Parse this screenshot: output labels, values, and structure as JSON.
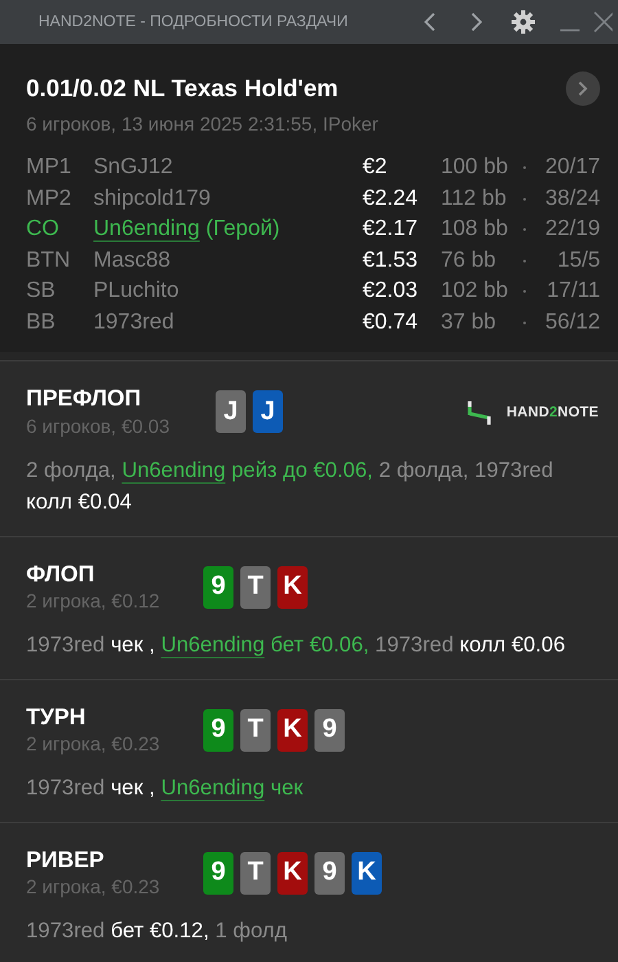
{
  "window": {
    "title": "HAND2NOTE - ПОДРОБНОСТИ РАЗДАЧИ"
  },
  "hand": {
    "game": "0.01/0.02 NL Texas Hold'em",
    "info": "6 игроков, 13 июня 2025 2:31:55, IPoker"
  },
  "players": [
    {
      "position": "MP1",
      "name": "SnGJ12",
      "hero": false,
      "stack": "€2",
      "bb": "100 bb",
      "stats": "20/17"
    },
    {
      "position": "MP2",
      "name": "shipcold179",
      "hero": false,
      "stack": "€2.24",
      "bb": "112 bb",
      "stats": "38/24"
    },
    {
      "position": "CO",
      "name": "Un6ending",
      "hero": true,
      "hero_label": "(Герой)",
      "stack": "€2.17",
      "bb": "108 bb",
      "stats": "22/19"
    },
    {
      "position": "BTN",
      "name": "Masc88",
      "hero": false,
      "stack": "€1.53",
      "bb": "76 bb",
      "stats": "15/5"
    },
    {
      "position": "SB",
      "name": "PLuchito",
      "hero": false,
      "stack": "€2.03",
      "bb": "102 bb",
      "stats": "17/11"
    },
    {
      "position": "BB",
      "name": "1973red",
      "hero": false,
      "stack": "€0.74",
      "bb": "37 bb",
      "stats": "56/12"
    }
  ],
  "logo": {
    "before": "HAND",
    "accent": "2",
    "after": "NOTE"
  },
  "streets": [
    {
      "name": "ПРЕФЛОП",
      "info": "6 игроков, €0.03",
      "logo": true,
      "cards": [
        {
          "rank": "J",
          "color": "#6a6a6a"
        },
        {
          "rank": "J",
          "color": "#0d5bb5"
        }
      ],
      "actions": [
        {
          "kind": "plain",
          "text": "2 фолда, "
        },
        {
          "kind": "hero-name",
          "text": "Un6ending"
        },
        {
          "kind": "hero",
          "text": " рейз до €0.06,"
        },
        {
          "kind": "plain",
          "text": " 2 фолда, 1973red "
        },
        {
          "kind": "bold",
          "text": "колл €0.04"
        }
      ]
    },
    {
      "name": "ФЛОП",
      "info": "2 игрока, €0.12",
      "cards": [
        {
          "rank": "9",
          "color": "#0e8a1b"
        },
        {
          "rank": "T",
          "color": "#6a6a6a"
        },
        {
          "rank": "K",
          "color": "#a30d0d"
        }
      ],
      "actions": [
        {
          "kind": "plain",
          "text": "1973red "
        },
        {
          "kind": "bold",
          "text": "чек , "
        },
        {
          "kind": "hero-name",
          "text": "Un6ending"
        },
        {
          "kind": "hero",
          "text": " бет €0.06,"
        },
        {
          "kind": "plain",
          "text": " 1973red "
        },
        {
          "kind": "bold",
          "text": "колл €0.06"
        }
      ]
    },
    {
      "name": "ТУРН",
      "info": "2 игрока, €0.23",
      "cards": [
        {
          "rank": "9",
          "color": "#0e8a1b"
        },
        {
          "rank": "T",
          "color": "#6a6a6a"
        },
        {
          "rank": "K",
          "color": "#a30d0d"
        },
        {
          "rank": "9",
          "color": "#6a6a6a"
        }
      ],
      "actions": [
        {
          "kind": "plain",
          "text": "1973red "
        },
        {
          "kind": "bold",
          "text": "чек , "
        },
        {
          "kind": "hero-name",
          "text": "Un6ending"
        },
        {
          "kind": "hero",
          "text": " чек"
        }
      ]
    },
    {
      "name": "РИВЕР",
      "info": "2 игрока, €0.23",
      "cards": [
        {
          "rank": "9",
          "color": "#0e8a1b"
        },
        {
          "rank": "T",
          "color": "#6a6a6a"
        },
        {
          "rank": "K",
          "color": "#a30d0d"
        },
        {
          "rank": "9",
          "color": "#6a6a6a"
        },
        {
          "rank": "K",
          "color": "#0d5bb5"
        }
      ],
      "actions": [
        {
          "kind": "plain",
          "text": "1973red "
        },
        {
          "kind": "bold",
          "text": "бет €0.12,"
        },
        {
          "kind": "plain",
          "text": " 1 фолд"
        }
      ]
    }
  ]
}
